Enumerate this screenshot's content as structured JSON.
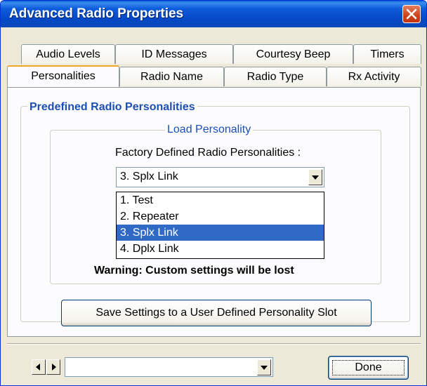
{
  "window": {
    "title": "Advanced Radio Properties"
  },
  "tabs": {
    "row1": [
      {
        "label": "Audio Levels"
      },
      {
        "label": "ID Messages"
      },
      {
        "label": "Courtesy Beep"
      },
      {
        "label": "Timers"
      }
    ],
    "row2": [
      {
        "label": "Personalities",
        "selected": true
      },
      {
        "label": "Radio Name"
      },
      {
        "label": "Radio Type"
      },
      {
        "label": "Rx Activity"
      }
    ]
  },
  "panel": {
    "group_title": "Predefined Radio Personalities",
    "inner_group_title": "Load Personality",
    "factory_label": "Factory Defined Radio Personalities :",
    "combo_value": "3. Splx Link",
    "options": [
      {
        "label": "1. Test",
        "selected": false
      },
      {
        "label": "2. Repeater",
        "selected": false
      },
      {
        "label": "3. Splx Link",
        "selected": true
      },
      {
        "label": "4. Dplx Link",
        "selected": false
      }
    ],
    "warning": "Warning: Custom settings will be lost",
    "save_button": "Save Settings to a User Defined Personality Slot"
  },
  "footer": {
    "combo_value": "",
    "done_button": "Done"
  },
  "colors": {
    "titlebar": "#0a5fd7",
    "group_title": "#1c4fb5",
    "selection": "#316ac5",
    "tab_highlight": "#f3a526"
  }
}
